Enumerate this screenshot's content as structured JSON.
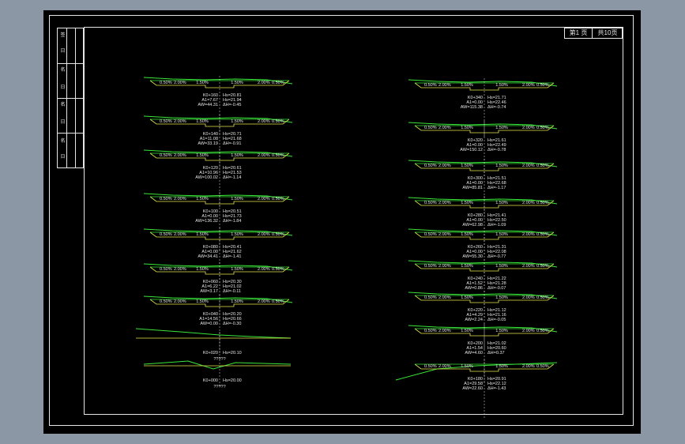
{
  "title_block": {
    "page_label": "第1 页",
    "total_label": "共10页"
  },
  "side_strip": {
    "labels": [
      "签",
      "日",
      "名",
      "日",
      "名",
      "日",
      "名",
      "日",
      "名",
      "日"
    ]
  },
  "colors": {
    "ground_line": "#39e639",
    "design_line": "#e6e64d",
    "center_line": "#e6e6e6",
    "text": "#e6e6e6",
    "frame": "#e6e6e6"
  },
  "slopes": {
    "s1": "0.50%",
    "s2": "2.00%",
    "s3": "1.50%"
  },
  "sections_left": [
    {
      "station": "K0+160",
      "hs": "Hs=20.81",
      "a1": "A1=7.67",
      "a2": "Hs=21.94",
      "aw": "AW=44.31",
      "dh": "ΔH=-0.45",
      "kind": "road"
    },
    {
      "station": "K0+140",
      "hs": "Hs=20.71",
      "a1": "A1=11.08",
      "a2": "Hs=21.68",
      "aw": "AW=33.19",
      "dh": "ΔH=-0.91",
      "kind": "road"
    },
    {
      "station": "K0+120",
      "hs": "Hs=20.61",
      "a1": "A1=10.96",
      "a2": "Hs=21.53",
      "aw": "AW=100.02",
      "dh": "ΔH=-1.14",
      "kind": "road"
    },
    {
      "station": "K0+100",
      "hs": "Hs=20.51",
      "a1": "A1=0.00",
      "a2": "Hs=21.73",
      "aw": "AW=136.32",
      "dh": "ΔH=-1.84",
      "kind": "road"
    },
    {
      "station": "K0+080",
      "hs": "Hs=20.41",
      "a1": "A1=0.00",
      "a2": "Hs=21.62",
      "aw": "AW=34.41",
      "dh": "ΔH=-1.41",
      "kind": "road"
    },
    {
      "station": "K0+060",
      "hs": "Hs=20.30",
      "a1": "A1=6.22",
      "a2": "Hs=21.02",
      "aw": "AW=3.17",
      "dh": "ΔH=-0.11",
      "kind": "road"
    },
    {
      "station": "K0+040",
      "hs": "Hs=20.20",
      "a1": "A1=14.56",
      "a2": "Hs=20.66",
      "aw": "AW=0.00",
      "dh": "ΔH=-0.30",
      "kind": "road"
    },
    {
      "station": "K0+020",
      "hs": "Hs=20.10",
      "a1": "",
      "a2": "",
      "aw": "",
      "dh": "",
      "note": "?????",
      "kind": "flat1"
    },
    {
      "station": "K0+000",
      "hs": "Hs=20.00",
      "a1": "",
      "a2": "",
      "aw": "",
      "dh": "",
      "note": "?????",
      "kind": "flat2"
    }
  ],
  "sections_right": [
    {
      "station": "K0+340",
      "hs": "Hs=21.71",
      "a1": "A1=0.00",
      "a2": "Hs=22.46",
      "aw": "AW=115.38",
      "dh": "ΔH=-0.74",
      "kind": "road"
    },
    {
      "station": "K0+320",
      "hs": "Hs=21.61",
      "a1": "A1=0.00",
      "a2": "Hs=22.49",
      "aw": "AW=150.12",
      "dh": "ΔH=-0.78",
      "kind": "road"
    },
    {
      "station": "K0+300",
      "hs": "Hs=21.51",
      "a1": "A1=0.00",
      "a2": "Hs=22.68",
      "aw": "AW=85.81",
      "dh": "ΔH=-1.17",
      "kind": "road"
    },
    {
      "station": "K0+280",
      "hs": "Hs=21.41",
      "a1": "A1=0.00",
      "a2": "Hs=22.50",
      "aw": "AW=62.98",
      "dh": "ΔH=-1.09",
      "kind": "road"
    },
    {
      "station": "K0+260",
      "hs": "Hs=21.31",
      "a1": "A1=0.00",
      "a2": "Hs=22.08",
      "aw": "AW=55.30",
      "dh": "ΔH=-0.77",
      "kind": "road"
    },
    {
      "station": "K0+240",
      "hs": "Hs=21.22",
      "a1": "A1=1.52",
      "a2": "Hs=21.28",
      "aw": "AW=0.86",
      "dh": "ΔH=-0.07",
      "kind": "road"
    },
    {
      "station": "K0+220",
      "hs": "Hs=21.12",
      "a1": "A1=4.29",
      "a2": "Hs=21.16",
      "aw": "AW=2.24",
      "dh": "ΔH=-0.05",
      "kind": "road"
    },
    {
      "station": "K0+200",
      "hs": "Hs=21.02",
      "a1": "A1=1.54",
      "a2": "Hs=20.60",
      "aw": "AW=4.60",
      "dh": "ΔH=0.37",
      "kind": "road"
    },
    {
      "station": "K0+180",
      "hs": "Hs=20.91",
      "a1": "A1=29.58",
      "a2": "Hs=22.12",
      "aw": "AW=22.60",
      "dh": "ΔH=-1.43",
      "kind": "wide"
    }
  ]
}
